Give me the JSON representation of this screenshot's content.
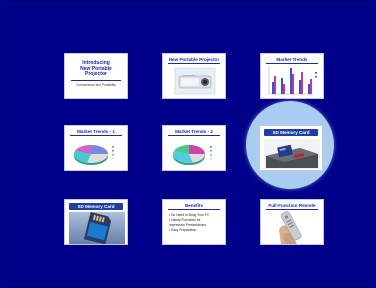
{
  "slides": [
    {
      "title": "Introducing\nNew Portable\nProjector",
      "subtitle": "Convenience and Portability"
    },
    {
      "title": "New Portable Projector"
    },
    {
      "title": "Market Trends"
    },
    {
      "title": "Market Trends - 1"
    },
    {
      "title": "Market Trends - 2"
    },
    {
      "title": "SD Memory Card"
    },
    {
      "title": "SD Memory Card"
    },
    {
      "title": "Benefits",
      "bullets": [
        "• No Need to Bring Your PC",
        "• Handy Functions for",
        "   Impressive Presentations",
        "• Easy Preparation"
      ]
    },
    {
      "title": "Full-Function Remote"
    }
  ],
  "colors": {
    "background": "#00008b",
    "highlight": "#a9cdf0",
    "title_blue": "#1a2aa8",
    "title_bar": "#1f3fa6"
  },
  "selected_slide": 6
}
